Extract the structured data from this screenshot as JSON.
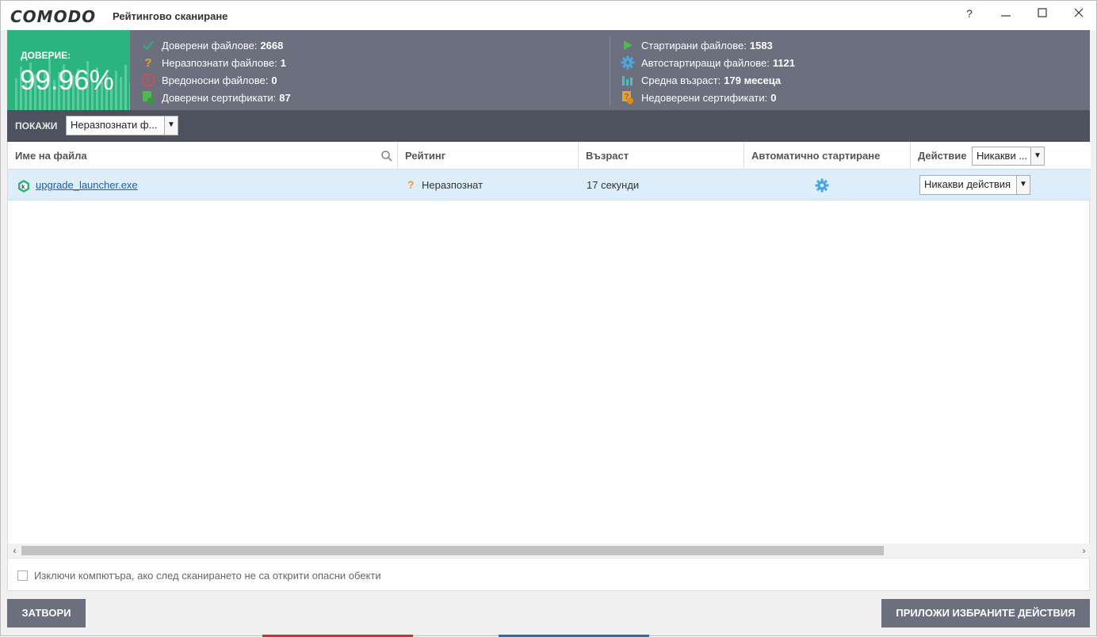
{
  "titlebar": {
    "brand": "COMODO",
    "title": "Рейтингово сканиране",
    "help": "?",
    "minimize": "—",
    "maximize": "☐",
    "close": "✕"
  },
  "trust": {
    "label": "ДОВЕРИЕ:",
    "value": "99.96%"
  },
  "stats_left": [
    {
      "label": "Доверени файлове:",
      "value": "2668",
      "icon": "check-icon",
      "color": "#2cb47f"
    },
    {
      "label": "Неразпознати файлове:",
      "value": "1",
      "icon": "question-icon",
      "color": "#f0a020"
    },
    {
      "label": "Вредоносни файлове:",
      "value": "0",
      "icon": "alert-icon",
      "color": "#e24a4a"
    },
    {
      "label": "Доверени сертификати:",
      "value": "87",
      "icon": "certificate-icon",
      "color": "#4cba4c"
    }
  ],
  "stats_right": [
    {
      "label": "Стартирани файлове:",
      "value": "1583",
      "icon": "play-icon",
      "color": "#4cba4c"
    },
    {
      "label": "Автостартиращи файлове:",
      "value": "1121",
      "icon": "gear-icon",
      "color": "#4aa8e0"
    },
    {
      "label": "Средна възраст:",
      "value": "179 месеца",
      "icon": "bar-chart-icon",
      "color": "#4ac0c0"
    },
    {
      "label": "Недоверени сертификати:",
      "value": "0",
      "icon": "warning-certificate-icon",
      "color": "#f0a020"
    }
  ],
  "filter": {
    "label": "ПОКАЖИ",
    "selected": "Неразпознати ф..."
  },
  "table": {
    "headers": {
      "name": "Име на файла",
      "rating": "Рейтинг",
      "age": "Възраст",
      "autostart": "Автоматично стартиране",
      "action": "Действие",
      "action_all": "Никакви ..."
    },
    "rows": [
      {
        "name": "upgrade_launcher.exe",
        "rating": "Неразпознат",
        "age": "17 секунди",
        "action": "Никакви действия"
      }
    ]
  },
  "option": {
    "label": "Изключи компютъра, ако след сканирането не са открити опасни обекти",
    "checked": false
  },
  "buttons": {
    "close": "ЗАТВОРИ",
    "apply": "ПРИЛОЖИ ИЗБРАНИТЕ ДЕЙСТВИЯ"
  }
}
